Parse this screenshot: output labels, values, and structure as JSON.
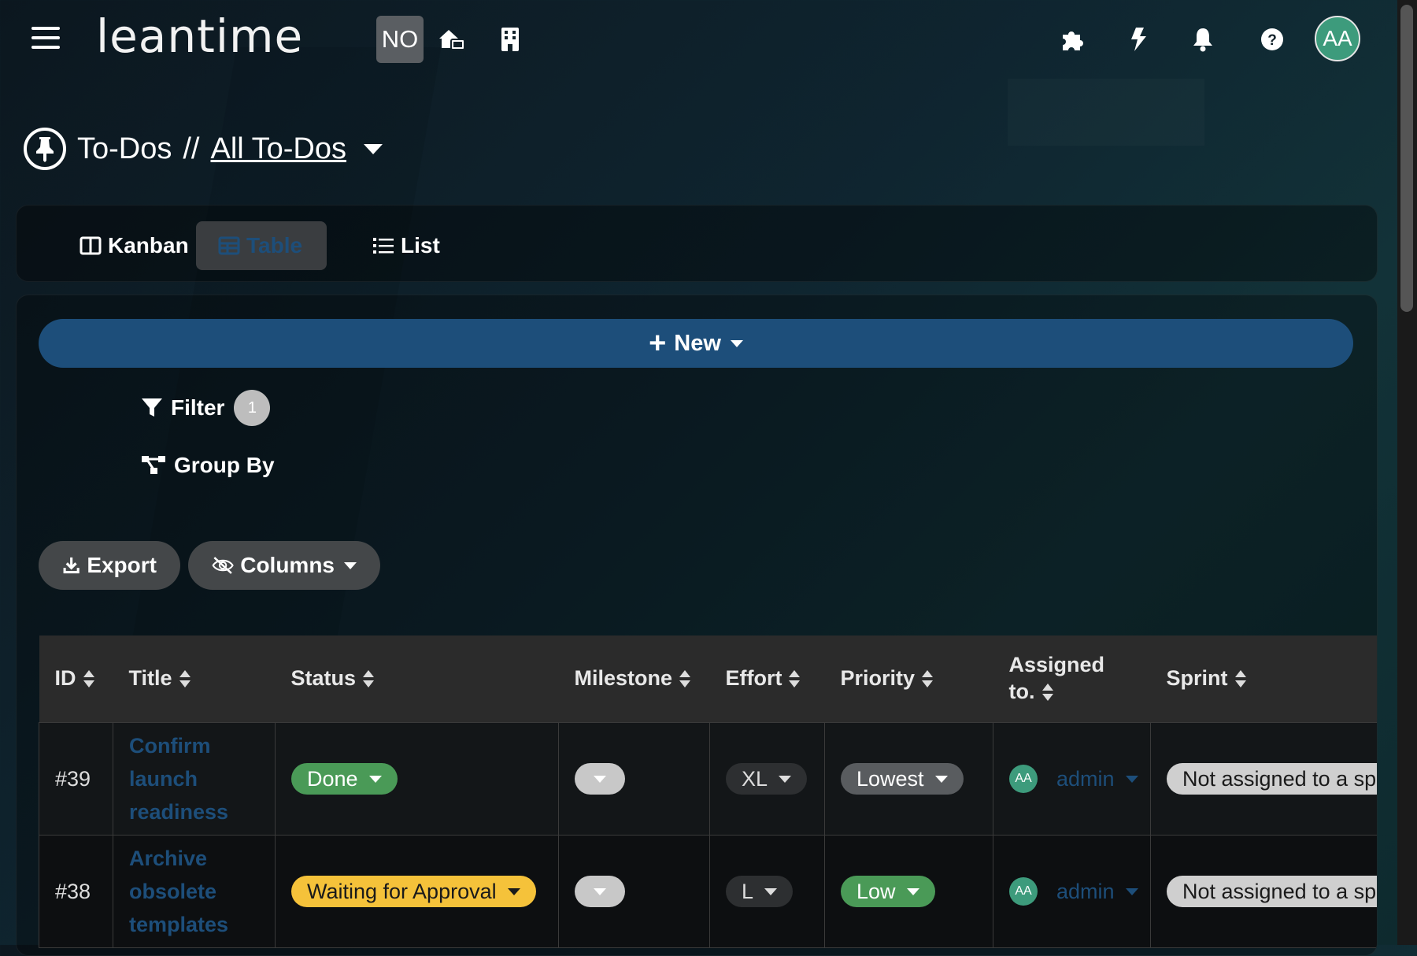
{
  "header": {
    "logo": "leantime",
    "workspace_badge": "NO",
    "avatar_initials": "AA",
    "icons": [
      "home-icon",
      "building-icon",
      "puzzle-icon",
      "lightning-icon",
      "bell-icon",
      "help-icon"
    ]
  },
  "breadcrumb": {
    "section": "To-Dos",
    "separator": "//",
    "current": "All To-Dos"
  },
  "views": {
    "kanban": "Kanban",
    "table": "Table",
    "list": "List",
    "active": "Table"
  },
  "toolbar": {
    "new_label": "New",
    "filter_label": "Filter",
    "filter_count": "1",
    "groupby_label": "Group By",
    "export_label": "Export",
    "columns_label": "Columns"
  },
  "table": {
    "headers": {
      "id": "ID",
      "title": "Title",
      "status": "Status",
      "milestone": "Milestone",
      "effort": "Effort",
      "priority": "Priority",
      "assigned_1": "Assigned",
      "assigned_2": "to.",
      "sprint": "Sprint"
    },
    "rows": [
      {
        "id": "#39",
        "title_lines": [
          "Confirm",
          "launch",
          "readiness"
        ],
        "status": "Done",
        "effort": "XL",
        "priority": "Lowest",
        "assignee_initials": "AA",
        "assignee": "admin",
        "sprint": "Not assigned to a sprint"
      },
      {
        "id": "#38",
        "title_lines": [
          "Archive",
          "obsolete",
          "templates"
        ],
        "status": "Waiting for Approval",
        "effort": "L",
        "priority": "Low",
        "assignee_initials": "AA",
        "assignee": "admin",
        "sprint": "Not assigned to a sprint"
      }
    ]
  },
  "colors": {
    "accent": "#1d4e7a",
    "done": "#4a9a57",
    "waiting": "#f5c23a",
    "avatar": "#3d9b7c"
  }
}
